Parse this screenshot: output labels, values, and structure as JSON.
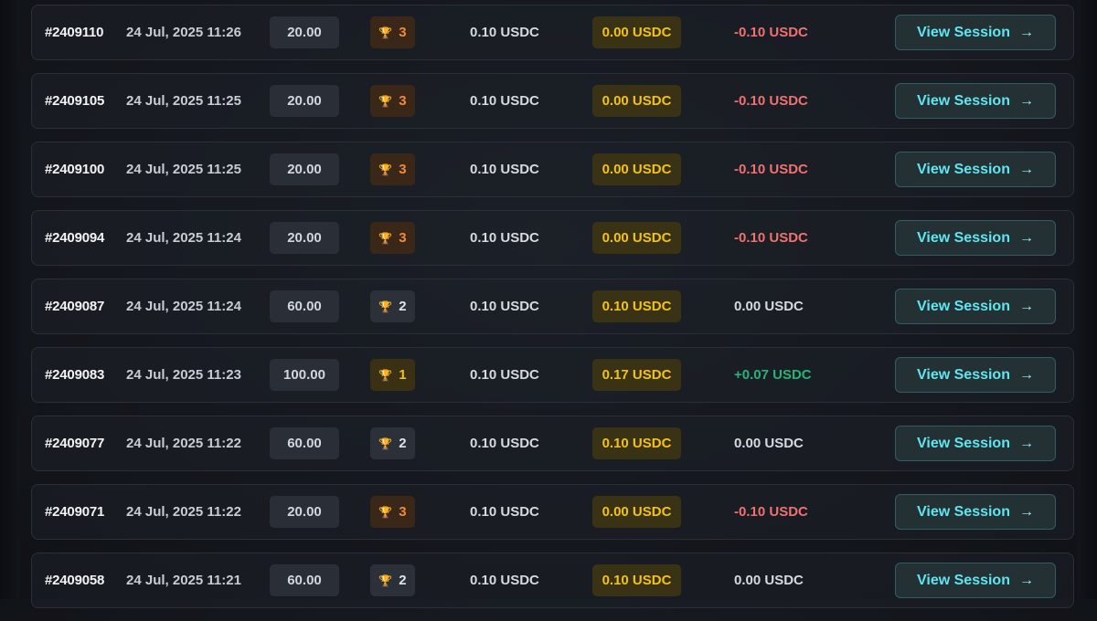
{
  "button_label": "View Session",
  "trophy_icon": "trophy-icon",
  "arrow_icon": "arrow-right-icon",
  "colors": {
    "button_text": "#5fe6f0",
    "payout_text": "#f2c218",
    "loss": "#f07171",
    "gain": "#27b377",
    "rank_1": "#f3c21c",
    "rank_2": "#e0e2e6",
    "rank_3": "#f08a3c"
  },
  "sessions": [
    {
      "id": "#2409110",
      "date": "24 Jul, 2025 11:26",
      "multiplier": "20.00",
      "rank": "3",
      "bet": "0.10 USDC",
      "payout": "0.00 USDC",
      "profit": "-0.10 USDC",
      "profit_sign": "neg"
    },
    {
      "id": "#2409105",
      "date": "24 Jul, 2025 11:25",
      "multiplier": "20.00",
      "rank": "3",
      "bet": "0.10 USDC",
      "payout": "0.00 USDC",
      "profit": "-0.10 USDC",
      "profit_sign": "neg"
    },
    {
      "id": "#2409100",
      "date": "24 Jul, 2025 11:25",
      "multiplier": "20.00",
      "rank": "3",
      "bet": "0.10 USDC",
      "payout": "0.00 USDC",
      "profit": "-0.10 USDC",
      "profit_sign": "neg"
    },
    {
      "id": "#2409094",
      "date": "24 Jul, 2025 11:24",
      "multiplier": "20.00",
      "rank": "3",
      "bet": "0.10 USDC",
      "payout": "0.00 USDC",
      "profit": "-0.10 USDC",
      "profit_sign": "neg"
    },
    {
      "id": "#2409087",
      "date": "24 Jul, 2025 11:24",
      "multiplier": "60.00",
      "rank": "2",
      "bet": "0.10 USDC",
      "payout": "0.10 USDC",
      "profit": "0.00 USDC",
      "profit_sign": "zero"
    },
    {
      "id": "#2409083",
      "date": "24 Jul, 2025 11:23",
      "multiplier": "100.00",
      "rank": "1",
      "bet": "0.10 USDC",
      "payout": "0.17 USDC",
      "profit": "+0.07 USDC",
      "profit_sign": "pos"
    },
    {
      "id": "#2409077",
      "date": "24 Jul, 2025 11:22",
      "multiplier": "60.00",
      "rank": "2",
      "bet": "0.10 USDC",
      "payout": "0.10 USDC",
      "profit": "0.00 USDC",
      "profit_sign": "zero"
    },
    {
      "id": "#2409071",
      "date": "24 Jul, 2025 11:22",
      "multiplier": "20.00",
      "rank": "3",
      "bet": "0.10 USDC",
      "payout": "0.00 USDC",
      "profit": "-0.10 USDC",
      "profit_sign": "neg"
    },
    {
      "id": "#2409058",
      "date": "24 Jul, 2025 11:21",
      "multiplier": "60.00",
      "rank": "2",
      "bet": "0.10 USDC",
      "payout": "0.10 USDC",
      "profit": "0.00 USDC",
      "profit_sign": "zero"
    }
  ]
}
